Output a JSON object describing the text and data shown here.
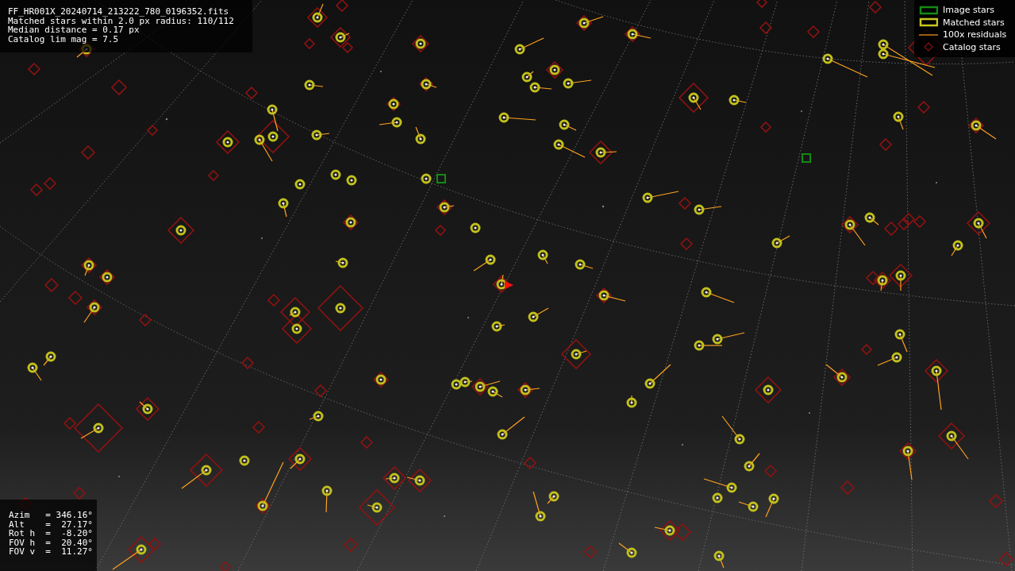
{
  "file_info": {
    "lines": [
      "FF_HR001X_20240714_213222_780_0196352.fits",
      "Matched stars within 2.0 px radius: 110/112",
      "Median distance = 0.17 px",
      "Catalog lim mag = 7.5"
    ]
  },
  "legend": {
    "items": [
      {
        "label": "Image stars"
      },
      {
        "kind": "matched",
        "label": "Matched stars"
      },
      {
        "kind": "residual",
        "label": "100x residuals"
      },
      {
        "kind": "catalog",
        "label": "Catalog stars"
      }
    ]
  },
  "pointing": {
    "lines": [
      "Azim   = 346.16°",
      "Alt    =  27.17°",
      "Rot h  =  -8.20°",
      "FOV h  =  20.40°",
      "FOV v  =  11.27°"
    ]
  }
}
